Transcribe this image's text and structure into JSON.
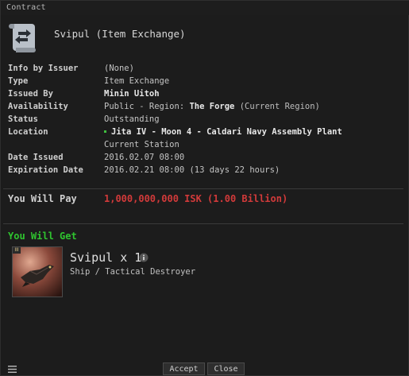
{
  "window": {
    "title": "Contract"
  },
  "header": {
    "title": "Svipul (Item Exchange)",
    "icon": "contract-scroll-icon"
  },
  "info": {
    "info_by_issuer": {
      "label": "Info by Issuer",
      "value": "(None)"
    },
    "type": {
      "label": "Type",
      "value": "Item Exchange"
    },
    "issued_by": {
      "label": "Issued By",
      "value": "Minin Uitoh"
    },
    "availability": {
      "label": "Availability",
      "prefix": "Public - Region:",
      "region": "The Forge",
      "suffix": "(Current Region)"
    },
    "status": {
      "label": "Status",
      "value": "Outstanding"
    },
    "location": {
      "label": "Location",
      "value": "Jita IV - Moon 4 - Caldari Navy Assembly Plant",
      "note": "Current Station"
    },
    "date_issued": {
      "label": "Date Issued",
      "value": "2016.02.07 08:00"
    },
    "expiration_date": {
      "label": "Expiration Date",
      "value": "2016.02.21 08:00 (13 days 22 hours)"
    }
  },
  "payment": {
    "label": "You Will Pay",
    "value": "1,000,000,000 ISK (1.00 Billion)",
    "color": "#d23a3a"
  },
  "receive": {
    "label": "You Will Get",
    "color": "#2fc42f",
    "item": {
      "name": "Svipul x 1",
      "subtitle": "Ship / Tactical Destroyer",
      "badge": "III"
    }
  },
  "buttons": {
    "accept": "Accept",
    "close": "Close"
  }
}
